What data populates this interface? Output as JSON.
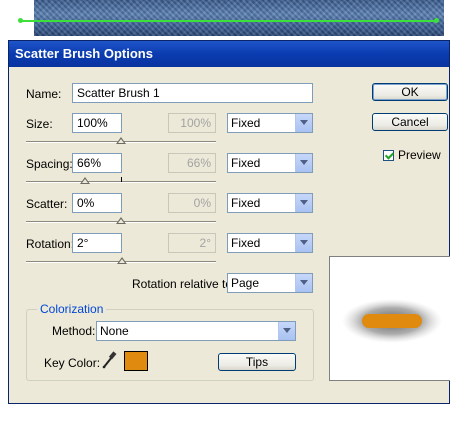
{
  "dialog": {
    "title": "Scatter Brush Options"
  },
  "name": {
    "label": "Name:",
    "value": "Scatter Brush 1"
  },
  "rows": [
    {
      "label": "Size:",
      "value": "100%",
      "max_value": "100%",
      "mode": "Fixed"
    },
    {
      "label": "Spacing:",
      "value": "66%",
      "max_value": "66%",
      "mode": "Fixed"
    },
    {
      "label": "Scatter:",
      "value": "0%",
      "max_value": "0%",
      "mode": "Fixed"
    },
    {
      "label": "Rotation:",
      "value": "2°",
      "max_value": "2°",
      "mode": "Fixed"
    }
  ],
  "rotation_relative": {
    "label": "Rotation relative to:",
    "value": "Page"
  },
  "buttons": {
    "ok": "OK",
    "cancel": "Cancel",
    "tips": "Tips"
  },
  "preview": {
    "label": "Preview",
    "checked": true
  },
  "colorization": {
    "group_title": "Colorization",
    "method_label": "Method:",
    "method_value": "None",
    "key_color_label": "Key Color:",
    "key_color": "#e08a10"
  },
  "colors": {
    "titlebar": "#0a3cb0",
    "brush_fill": "#e08a10"
  }
}
